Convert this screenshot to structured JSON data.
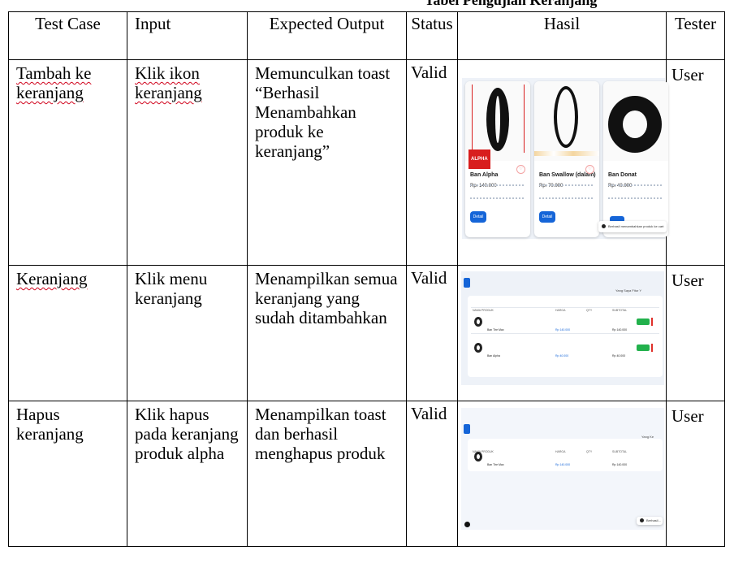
{
  "caption_fragment": "Tabel Pengujian Keranjang",
  "table": {
    "headers": [
      "Test Case",
      "Input",
      "Expected Output",
      "Status",
      "Hasil",
      "Tester"
    ],
    "rows": [
      {
        "test_case": "Tambah ke keranjang",
        "input": "Klik ikon keranjang",
        "expected": "Memunculkan toast “Berhasil Menambahkan produk ke keranjang”",
        "status": "Valid",
        "tester": "User"
      },
      {
        "test_case": "Keranjang",
        "input": "Klik menu keranjang",
        "expected": "Menampilkan semua keranjang yang sudah ditambahkan",
        "status": "Valid",
        "tester": "User"
      },
      {
        "test_case": "Hapus keranjang",
        "input": "Klik hapus pada keranjang produk alpha",
        "expected": "Menampilkan toast dan berhasil menghapus produk",
        "status": "Valid",
        "tester": "User"
      }
    ]
  },
  "shot1": {
    "products": [
      {
        "name": "Ban Alpha",
        "price": "Rp. 140.000",
        "button": "Detail",
        "brand": "ALPHA"
      },
      {
        "name": "Ban Swallow (dalam)",
        "price": "Rp. 70.000",
        "button": "Detail"
      },
      {
        "name": "Ban Donat",
        "price": "Rp. 40.000",
        "button": "Detail"
      }
    ],
    "toast": "Berhasil menambahkan produk ke cart"
  },
  "shot2": {
    "nav": "Yang   Saya   Fitur   Y",
    "columns": [
      "NAMA PRODUK",
      "HARGA",
      "QTY",
      "SUBTOTAL"
    ],
    "items": [
      {
        "name": "Ban Tire Max",
        "price": "Rp 140.000",
        "subtotal": "Rp 140.000"
      },
      {
        "name": "Ban Alpha",
        "price": "Rp 40.000",
        "subtotal": "Rp 40.000"
      }
    ]
  },
  "shot3": {
    "nav": "Yang   Ke",
    "columns": [
      "NAMA PRODUK",
      "HARGA",
      "QTY",
      "SUBTOTAL"
    ],
    "item": {
      "name": "Ban Tire Max",
      "price": "Rp 140.000",
      "subtotal": "Rp 140.000"
    },
    "toast": "Berhasil..."
  },
  "colors": {
    "accent_blue": "#1565d8",
    "green": "#22b14c",
    "spell_underline": "#d0021b"
  }
}
